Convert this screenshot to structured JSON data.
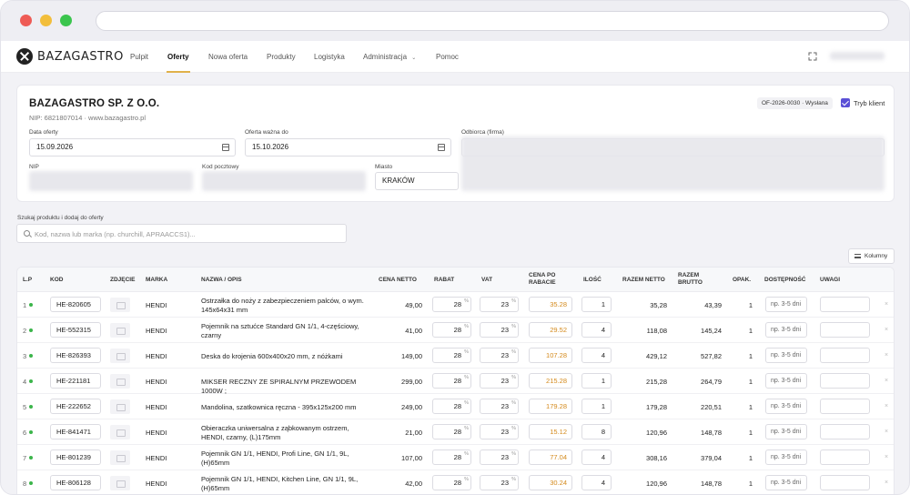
{
  "nav": {
    "logo": "BAZAGASTRO",
    "items": [
      "Pulpit",
      "Oferty",
      "Nowa oferta",
      "Produkty",
      "Logistyka",
      "Administracja",
      "Pomoc"
    ],
    "active": "Oferty"
  },
  "header": {
    "company": "BAZAGASTRO SP. Z O.O.",
    "nip_line": "NIP: 6821807014 · www.bazagastro.pl",
    "badge": "OF-2026-0030 · Wysłana",
    "client_mode_label": "Tryb klient",
    "client_mode_checked": true
  },
  "form": {
    "data_oferty_label": "Data oferty",
    "data_oferty": "15.09.2026",
    "oferta_wazna_label": "Oferta ważna do",
    "oferta_wazna": "15.10.2026",
    "odbiorca_label": "Odbiorca (firma)",
    "nip_label": "NIP",
    "kod_pocztowy_label": "Kod pocztowy",
    "miasto_label": "Miasto",
    "miasto": "KRAKÓW"
  },
  "search": {
    "label": "Szukaj produktu i dodaj do oferty",
    "placeholder": "Kod, nazwa lub marka (np. churchill, APRAACCS1)..."
  },
  "columns_button": "Kolumny",
  "table": {
    "headers": {
      "lp": "L.P",
      "kod": "KOD",
      "zdjecie": "ZDJĘCIE",
      "marka": "MARKA",
      "nazwa": "NAZWA / OPIS",
      "cena_netto": "CENA NETTO",
      "rabat": "RABAT",
      "vat": "VAT",
      "cena_po_rabacie": "CENA PO RABACIE",
      "ilosc": "ILOŚĆ",
      "razem_netto": "RAZEM NETTO",
      "razem_brutto": "RAZEM BRUTTO",
      "opak": "OPAK.",
      "dostepnosc": "DOSTĘPNOŚĆ",
      "uwagi": "UWAGI"
    },
    "rows": [
      {
        "lp": "1",
        "kod": "HE-820605",
        "marka": "HENDI",
        "nazwa": "Ostrzałka do noży z zabezpieczeniem palców, o wym. 145x64x31 mm",
        "cena_netto": "49,00",
        "rabat": "28",
        "vat": "23",
        "cena_po": "35.28",
        "ilosc": "1",
        "razem_netto": "35,28",
        "razem_brutto": "43,39",
        "opak": "1",
        "dost": "np. 3-5 dni"
      },
      {
        "lp": "2",
        "kod": "HE-552315",
        "marka": "HENDI",
        "nazwa": "Pojemnik na sztućce Standard GN 1/1, 4-częściowy, czarny",
        "cena_netto": "41,00",
        "rabat": "28",
        "vat": "23",
        "cena_po": "29.52",
        "ilosc": "4",
        "razem_netto": "118,08",
        "razem_brutto": "145,24",
        "opak": "1",
        "dost": "np. 3-5 dni"
      },
      {
        "lp": "3",
        "kod": "HE-826393",
        "marka": "HENDI",
        "nazwa": "Deska do krojenia 600x400x20 mm, z nóżkami",
        "cena_netto": "149,00",
        "rabat": "28",
        "vat": "23",
        "cena_po": "107.28",
        "ilosc": "4",
        "razem_netto": "429,12",
        "razem_brutto": "527,82",
        "opak": "1",
        "dost": "np. 3-5 dni"
      },
      {
        "lp": "4",
        "kod": "HE-221181",
        "marka": "HENDI",
        "nazwa": "MIKSER RECZNY ZE SPIRALNYM PRZEWODEM 1000W ;",
        "cena_netto": "299,00",
        "rabat": "28",
        "vat": "23",
        "cena_po": "215.28",
        "ilosc": "1",
        "razem_netto": "215,28",
        "razem_brutto": "264,79",
        "opak": "1",
        "dost": "np. 3-5 dni"
      },
      {
        "lp": "5",
        "kod": "HE-222652",
        "marka": "HENDI",
        "nazwa": "Mandolina, szatkownica ręczna - 395x125x200 mm",
        "cena_netto": "249,00",
        "rabat": "28",
        "vat": "23",
        "cena_po": "179.28",
        "ilosc": "1",
        "razem_netto": "179,28",
        "razem_brutto": "220,51",
        "opak": "1",
        "dost": "np. 3-5 dni"
      },
      {
        "lp": "6",
        "kod": "HE-841471",
        "marka": "HENDI",
        "nazwa": "Obieraczka uniwersalna z ząbkowanym ostrzem, HENDI, czarny, (L)175mm",
        "cena_netto": "21,00",
        "rabat": "28",
        "vat": "23",
        "cena_po": "15.12",
        "ilosc": "8",
        "razem_netto": "120,96",
        "razem_brutto": "148,78",
        "opak": "1",
        "dost": "np. 3-5 dni"
      },
      {
        "lp": "7",
        "kod": "HE-801239",
        "marka": "HENDI",
        "nazwa": "Pojemnik GN 1/1, HENDI, Profi Line, GN 1/1, 9L, (H)65mm",
        "cena_netto": "107,00",
        "rabat": "28",
        "vat": "23",
        "cena_po": "77.04",
        "ilosc": "4",
        "razem_netto": "308,16",
        "razem_brutto": "379,04",
        "opak": "1",
        "dost": "np. 3-5 dni"
      },
      {
        "lp": "8",
        "kod": "HE-806128",
        "marka": "HENDI",
        "nazwa": "Pojemnik GN 1/1, HENDI, Kitchen Line, GN 1/1, 9L, (H)65mm",
        "cena_netto": "42,00",
        "rabat": "28",
        "vat": "23",
        "cena_po": "30.24",
        "ilosc": "4",
        "razem_netto": "120,96",
        "razem_brutto": "148,78",
        "opak": "1",
        "dost": "np. 3-5 dni"
      }
    ]
  },
  "colors": {
    "accent": "#5b50d6",
    "price_highlight": "#d48a1c",
    "status_dot": "#3bb54a",
    "nav_underline": "#e0b14a"
  }
}
